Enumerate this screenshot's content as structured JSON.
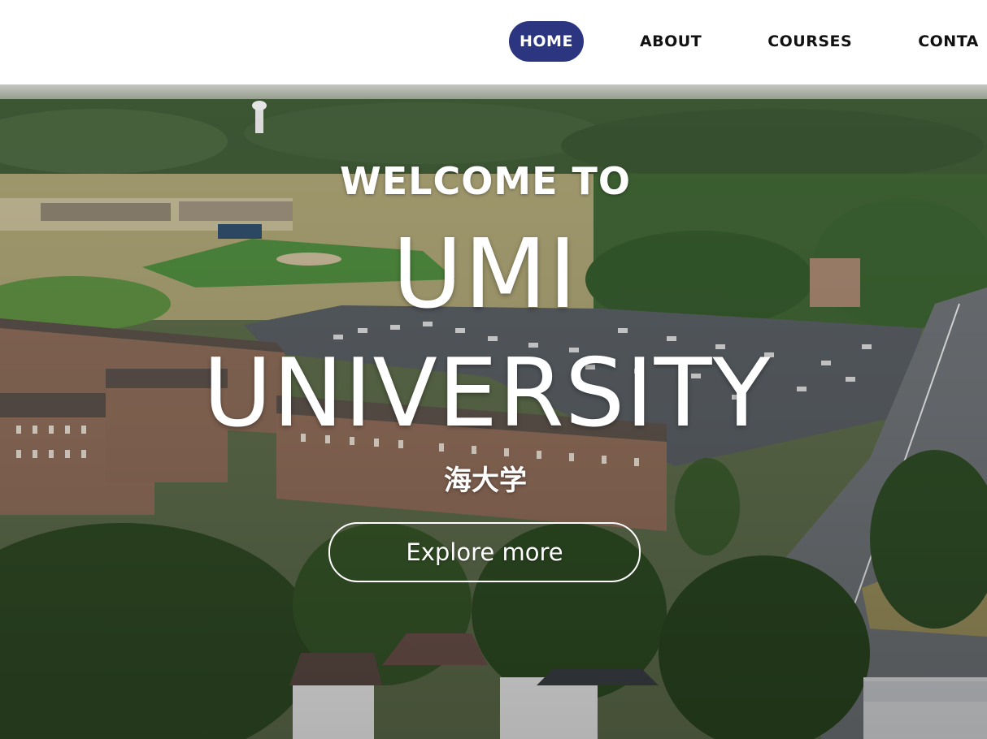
{
  "nav": {
    "items": [
      {
        "label": "HOME",
        "active": true
      },
      {
        "label": "ABOUT",
        "active": false
      },
      {
        "label": "CONTA",
        "active": false
      }
    ],
    "courses_label": "COURSES",
    "active_color": "#2b3580"
  },
  "hero": {
    "welcome": "WELCOME TO",
    "title_line1": "UMI",
    "title_line2": "UNIVERSITY",
    "chinese_name": "海大学",
    "cta_label": "Explore more",
    "background": "aerial-campus-photo"
  }
}
